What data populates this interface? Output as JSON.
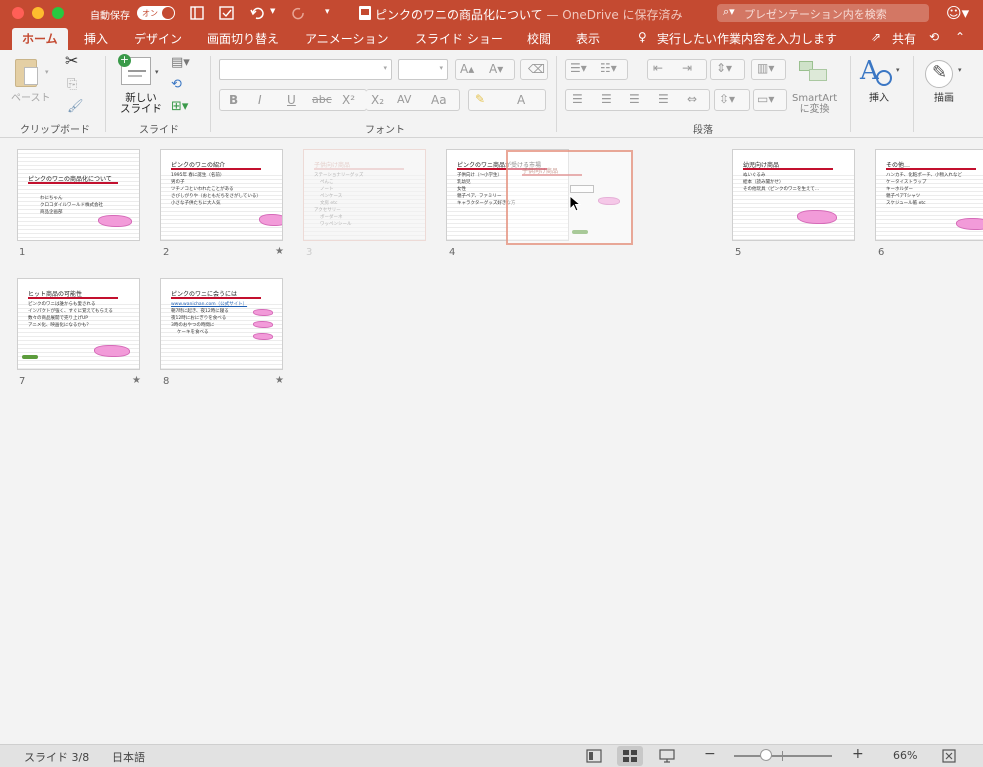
{
  "titlebar": {
    "autosave_label": "自動保存",
    "autosave_toggle": "オン",
    "doc_title": "ピンクのワニの商品化について",
    "doc_status": " — OneDrive に保存済み",
    "search_placeholder": "プレゼンテーション内を検索"
  },
  "tabs": [
    "ホーム",
    "挿入",
    "デザイン",
    "画面切り替え",
    "アニメーション",
    "スライド ショー",
    "校閲",
    "表示"
  ],
  "tell_me": "実行したい作業内容を入力します",
  "share_label": "共有",
  "ribbon": {
    "clipboard": {
      "label": "クリップボード",
      "paste": "ペースト"
    },
    "slides": {
      "label": "スライド",
      "new_slide": "新しい\nスライド"
    },
    "font": {
      "label": "フォント",
      "bold": "B",
      "italic": "I",
      "underline": "U",
      "strike": "abc",
      "superscript": "X²",
      "subscript": "X₂",
      "spacing": "AV",
      "case": "Aa",
      "grow": "A▴",
      "shrink": "A▾",
      "color": "A"
    },
    "paragraph": {
      "label": "段落",
      "smartart": "SmartArt\nに変換"
    },
    "insert": {
      "label": "挿入"
    },
    "draw": {
      "label": "描画"
    }
  },
  "slides": [
    {
      "num": "1",
      "title": "ピンクのワニの商品化について",
      "bullets": [
        "わにちゃん",
        "クロコダイルワールド株式会社",
        "商品企画部"
      ],
      "star": false
    },
    {
      "num": "2",
      "title": "ピンクのワニの紹介",
      "bullets": [
        "1995年 春に誕生（名前）",
        "男の子",
        "ツチノコといわれたことがある",
        "さびしがりや（おともだちをさがしている）",
        "小さな子供たちに大人気"
      ],
      "star": true
    },
    {
      "num": "3",
      "title": "子供向け商品",
      "bullets": [
        "ステーショナリーグッズ",
        "ぺんこ",
        "ノート",
        "ペンケース",
        "文房 etc",
        "アクセサリー",
        "ボーダーネ",
        "ワッペンシール"
      ],
      "star": false
    },
    {
      "num": "4",
      "title": "ピンクのワニ商品が受ける市場",
      "bullets": [
        "子供向け（〜小学生）",
        "乳幼児",
        "女性",
        "親子ペア、ファミリー",
        "キャラクターグッズ好きな方"
      ],
      "star": false
    },
    {
      "num": "5",
      "title": "幼児向け商品",
      "bullets": [
        "ぬいぐるみ",
        "絵本（読み聞かせ）",
        "その他玩具（ピンクのワニを生えて…"
      ],
      "star": false
    },
    {
      "num": "6",
      "title": "その他…",
      "bullets": [
        "ハンカチ、化粧ポーチ、小物入れなど",
        "ケータイストラップ",
        "キーホルダー",
        "親子ペアTシャツ",
        "スケジュール帳 etc"
      ],
      "star": false
    },
    {
      "num": "7",
      "title": "ヒット商品の可能性",
      "bullets": [
        "ピンクのワニは誰からも愛される",
        "インパクトが強く、すぐに覚えてもらえる",
        "数々の商品展開で売り上げUP",
        "アニメ化、映画化になるかも？"
      ],
      "star": true
    },
    {
      "num": "8",
      "title": "ピンクのワニに会うには",
      "bullets": [
        "www.wanichan.com（公式サイト）",
        "朝7時に起き、夜12時に寝る",
        "夜12時におにぎりを食べる",
        "3時のおやつの時間に",
        "ケーキを食べる"
      ],
      "star": true
    }
  ],
  "status": {
    "slide_indicator": "スライド 3/8",
    "language": "日本語",
    "zoom": "66%",
    "zoom_level": 0.33
  },
  "colors": {
    "accent": "#c44a31",
    "slide_rule": "#c3102e",
    "croc": "#f29bd9"
  }
}
